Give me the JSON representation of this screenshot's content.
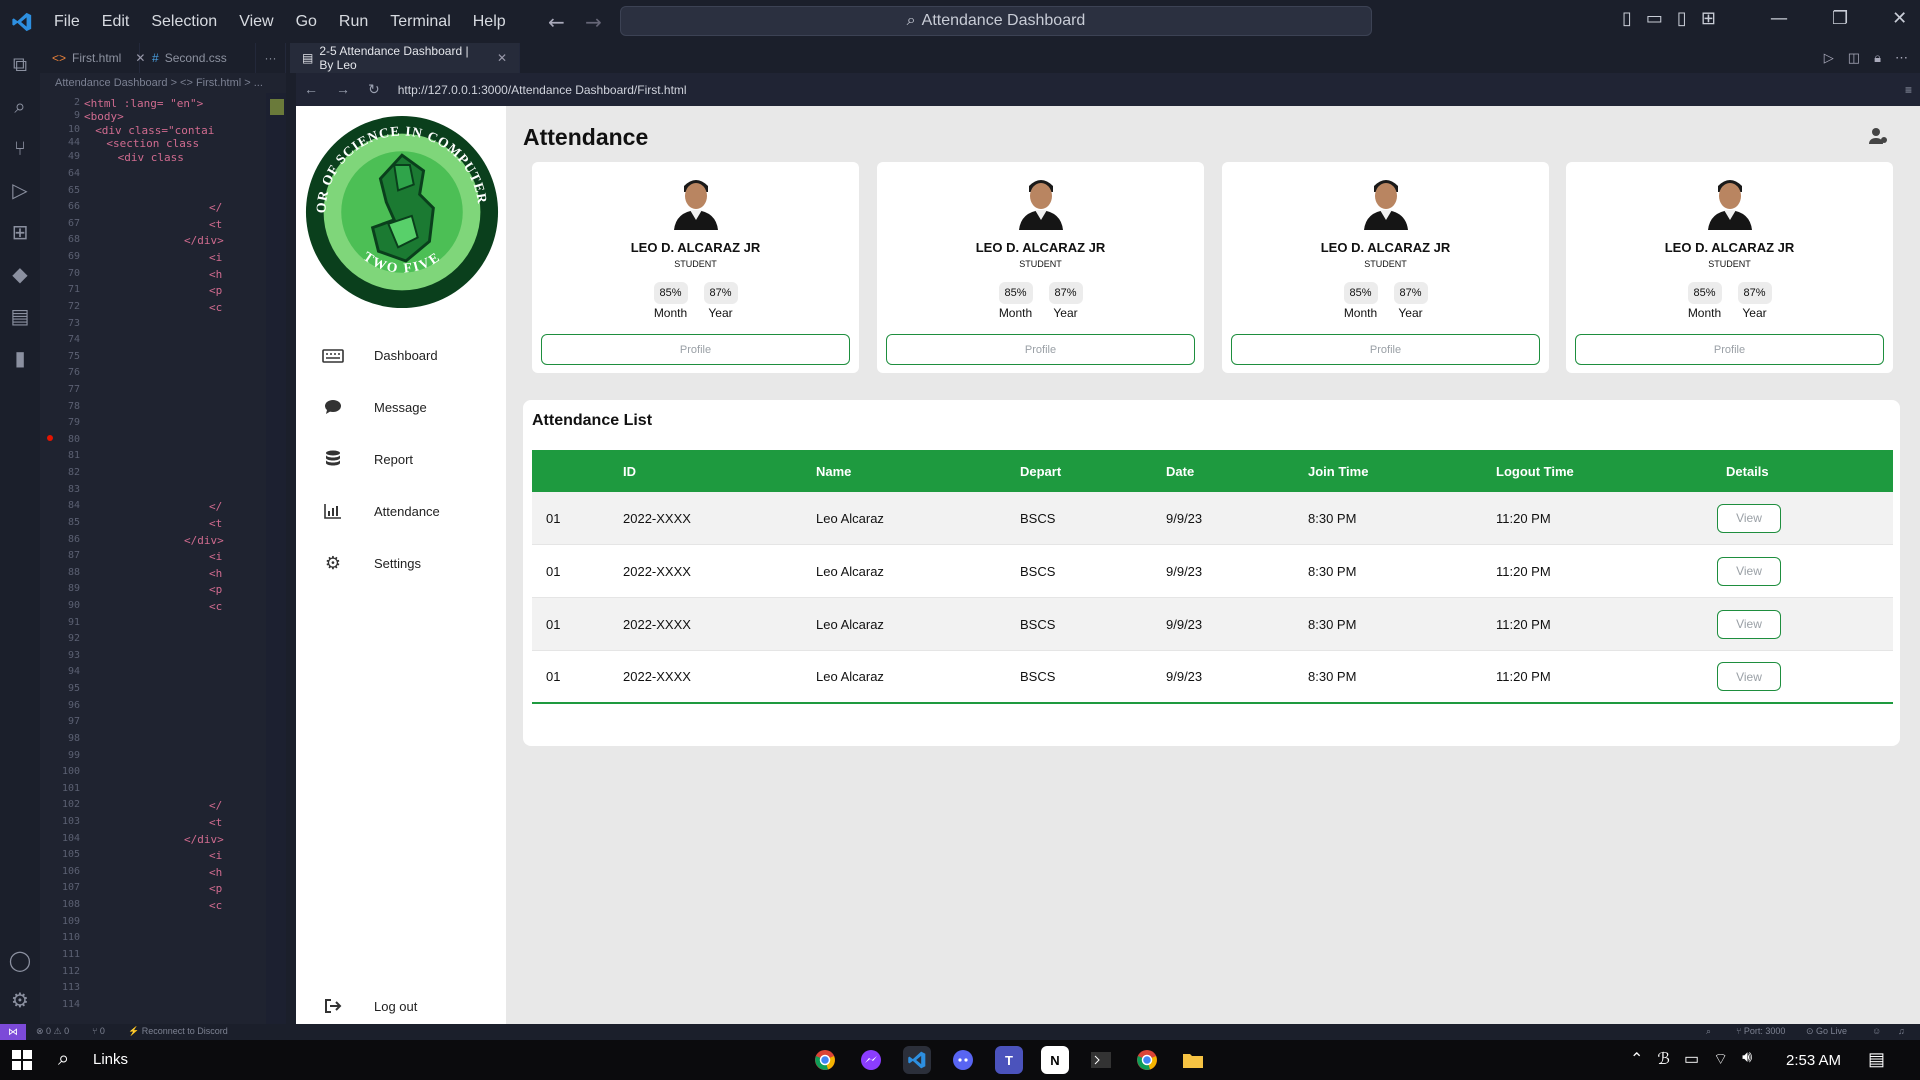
{
  "menu": [
    "File",
    "Edit",
    "Selection",
    "View",
    "Go",
    "Run",
    "Terminal",
    "Help"
  ],
  "command_center": "Attendance Dashboard",
  "editor_tabs": [
    {
      "label": "First.html",
      "icon": "html-icon"
    },
    {
      "label": "Second.css",
      "icon": "css-icon"
    },
    {
      "label": "2-5 Attendance Dashboard | By Leo",
      "icon": "preview-icon"
    }
  ],
  "overflow_label": "···",
  "breadcrumb": "Attendance Dashboard > <> First.html > ...",
  "code_lines": [
    {
      "n": "2",
      "indent": 0,
      "text": "<html :lang= \"en\">"
    },
    {
      "n": "9",
      "indent": 0,
      "text": "<body>"
    },
    {
      "n": "10",
      "indent": 2,
      "text": "<div class=\"contai"
    },
    {
      "n": "44",
      "indent": 4,
      "text": "<section class"
    },
    {
      "n": "49",
      "indent": 6,
      "text": "<div class"
    }
  ],
  "line_numbers": [
    "64",
    "65",
    "66",
    "67",
    "68",
    "69",
    "70",
    "71",
    "72",
    "73",
    "74",
    "75",
    "76",
    "77",
    "78",
    "79",
    "80",
    "81",
    "82",
    "83",
    "84",
    "85",
    "86",
    "87",
    "88",
    "89",
    "90",
    "91",
    "92",
    "93",
    "94",
    "95",
    "96",
    "97",
    "98",
    "99",
    "100",
    "101",
    "102",
    "103",
    "104",
    "105",
    "106",
    "107",
    "108",
    "109",
    "110",
    "111",
    "112",
    "113",
    "114"
  ],
  "code_snips": [
    {
      "row": 2,
      "indent": 10,
      "text": "</"
    },
    {
      "row": 3,
      "indent": 10,
      "text": "<t"
    },
    {
      "row": 4,
      "indent": 8,
      "text": "</div>"
    },
    {
      "row": 5,
      "indent": 10,
      "text": "<i"
    },
    {
      "row": 6,
      "indent": 10,
      "text": "<h"
    },
    {
      "row": 7,
      "indent": 10,
      "text": "<p"
    },
    {
      "row": 8,
      "indent": 10,
      "text": "<c"
    },
    {
      "row": 20,
      "indent": 10,
      "text": "</"
    },
    {
      "row": 21,
      "indent": 10,
      "text": "<t"
    },
    {
      "row": 22,
      "indent": 8,
      "text": "</div>"
    },
    {
      "row": 23,
      "indent": 10,
      "text": "<i"
    },
    {
      "row": 24,
      "indent": 10,
      "text": "<h"
    },
    {
      "row": 25,
      "indent": 10,
      "text": "<p"
    },
    {
      "row": 26,
      "indent": 10,
      "text": "<c"
    },
    {
      "row": 38,
      "indent": 10,
      "text": "</"
    },
    {
      "row": 39,
      "indent": 10,
      "text": "<t"
    },
    {
      "row": 40,
      "indent": 8,
      "text": "</div>"
    },
    {
      "row": 41,
      "indent": 10,
      "text": "<i"
    },
    {
      "row": 42,
      "indent": 10,
      "text": "<h"
    },
    {
      "row": 43,
      "indent": 10,
      "text": "<p"
    },
    {
      "row": 44,
      "indent": 10,
      "text": "<c"
    }
  ],
  "browser": {
    "url": "http://127.0.0.1:3000/Attendance Dashboard/First.html"
  },
  "webpage": {
    "logo": {
      "ring_top": "BACHELOR OF SCIENCE IN COMPUTER SCIENCE",
      "ring_bottom": "TWO FIVE"
    },
    "sidebar": [
      {
        "label": "Dashboard",
        "icon": "keyboard-icon"
      },
      {
        "label": "Message",
        "icon": "chat-icon"
      },
      {
        "label": "Report",
        "icon": "database-icon"
      },
      {
        "label": "Attendance",
        "icon": "bar-chart-icon"
      },
      {
        "label": "Settings",
        "icon": "gear-icon"
      }
    ],
    "logout": {
      "label": "Log out",
      "icon": "sign-out-icon"
    },
    "title": "Attendance",
    "cards": [
      {
        "name": "LEO D. ALCARAZ JR",
        "role": "STUDENT",
        "month": "85%",
        "month_label": "Month",
        "year": "87%",
        "year_label": "Year",
        "button": "Profile"
      },
      {
        "name": "LEO D. ALCARAZ JR",
        "role": "STUDENT",
        "month": "85%",
        "month_label": "Month",
        "year": "87%",
        "year_label": "Year",
        "button": "Profile"
      },
      {
        "name": "LEO D. ALCARAZ JR",
        "role": "STUDENT",
        "month": "85%",
        "month_label": "Month",
        "year": "87%",
        "year_label": "Year",
        "button": "Profile"
      },
      {
        "name": "LEO D. ALCARAZ JR",
        "role": "STUDENT",
        "month": "85%",
        "month_label": "Month",
        "year": "87%",
        "year_label": "Year",
        "button": "Profile"
      }
    ],
    "list_title": "Attendance List",
    "columns": [
      "",
      "ID",
      "Name",
      "Depart",
      "Date",
      "Join Time",
      "Logout Time",
      "Details"
    ],
    "rows": [
      [
        "01",
        "2022-XXXX",
        "Leo Alcaraz",
        "BSCS",
        "9/9/23",
        "8:30 PM",
        "11:20 PM",
        "View"
      ],
      [
        "01",
        "2022-XXXX",
        "Leo Alcaraz",
        "BSCS",
        "9/9/23",
        "8:30 PM",
        "11:20 PM",
        "View"
      ],
      [
        "01",
        "2022-XXXX",
        "Leo Alcaraz",
        "BSCS",
        "9/9/23",
        "8:30 PM",
        "11:20 PM",
        "View"
      ],
      [
        "01",
        "2022-XXXX",
        "Leo Alcaraz",
        "BSCS",
        "9/9/23",
        "8:30 PM",
        "11:20 PM",
        "View"
      ]
    ]
  },
  "status": {
    "problems": "⊗ 0 ⚠ 0",
    "ports_count": "⑂ 0",
    "discord": "Reconnect to Discord",
    "port": "Port: 3000",
    "golive": "Go Live"
  },
  "taskbar": {
    "search_label": "Links",
    "time": "2:53 AM"
  },
  "colors": {
    "accent_green": "#1e9a3f",
    "vscode_bg": "#1f2330"
  }
}
